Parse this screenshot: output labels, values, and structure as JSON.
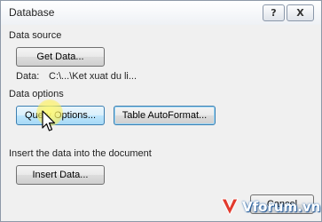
{
  "window": {
    "title": "Database",
    "help_button": "?",
    "close_button": "X"
  },
  "data_source": {
    "heading": "Data source",
    "get_data_label": "Get Data...",
    "data_label": "Data:",
    "data_path": "C:\\...\\Ket xuat du li..."
  },
  "data_options": {
    "heading": "Data options",
    "query_options_label": "Query Options...",
    "table_autoformat_label": "Table AutoFormat..."
  },
  "insert": {
    "heading": "Insert the data into the document",
    "insert_data_label": "Insert Data..."
  },
  "footer": {
    "cancel_label": "Cancel"
  },
  "watermark": {
    "text": "Vforum.vn"
  },
  "colors": {
    "dialog_background": "#f0f0f0",
    "hover_button_border": "#3c7fb1",
    "cursor_highlight": "#fff078"
  },
  "icons": [
    "help-icon",
    "close-icon",
    "mouse-pointer-icon",
    "vforum-logo-icon"
  ]
}
